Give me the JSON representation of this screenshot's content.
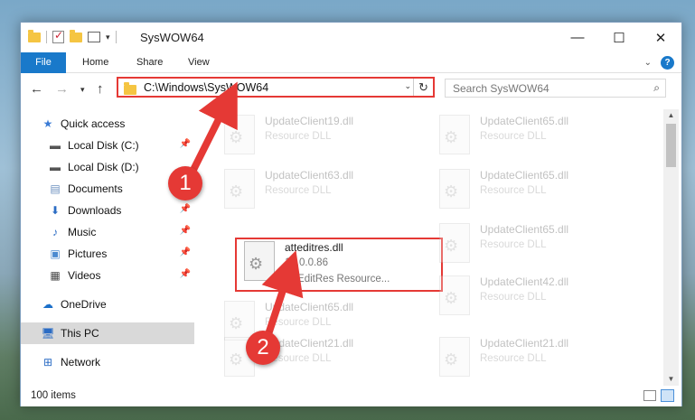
{
  "window": {
    "title": "SysWOW64",
    "controls": {
      "minimize": "—",
      "maximize": "☐",
      "close": "✕"
    }
  },
  "ribbon": {
    "tabs": [
      "File",
      "Home",
      "Share",
      "View"
    ],
    "help": "?",
    "collapse": "⌄"
  },
  "nav": {
    "back": "←",
    "forward": "→",
    "recent": "▾",
    "up": "↑",
    "address": "C:\\Windows\\SysWOW64",
    "address_dropdown": "⌄",
    "refresh": "↻",
    "search_placeholder": "Search SysWOW64",
    "search_icon": "⌕"
  },
  "sidebar": {
    "items": [
      {
        "label": "Quick access",
        "icon": "star-icon",
        "pinned": false
      },
      {
        "label": "Local Disk (C:)",
        "icon": "drive-icon",
        "pinned": true
      },
      {
        "label": "Local Disk (D:)",
        "icon": "drive-icon",
        "pinned": false
      },
      {
        "label": "Documents",
        "icon": "documents-icon",
        "pinned": true
      },
      {
        "label": "Downloads",
        "icon": "download-icon",
        "pinned": true
      },
      {
        "label": "Music",
        "icon": "music-icon",
        "pinned": true
      },
      {
        "label": "Pictures",
        "icon": "pictures-icon",
        "pinned": true
      },
      {
        "label": "Videos",
        "icon": "videos-icon",
        "pinned": true
      },
      {
        "label": "OneDrive",
        "icon": "cloud-icon",
        "pinned": false
      },
      {
        "label": "This PC",
        "icon": "pc-icon",
        "pinned": false,
        "selected": true
      },
      {
        "label": "Network",
        "icon": "network-icon",
        "pinned": false
      }
    ]
  },
  "files": {
    "faded": [
      {
        "name": "UpdateClient19.dll",
        "type": "Resource DLL"
      },
      {
        "name": "UpdateClient65.dll",
        "type": "Resource DLL"
      },
      {
        "name": "UpdateClient63.dll",
        "type": "Resource DLL"
      },
      {
        "name": "UpdateClient65.dll",
        "type": "Resource DLL"
      },
      {
        "name": "UpdateClient65.dll",
        "type": "Resource DLL"
      },
      {
        "name": "UpdateClient65.dll",
        "type": "Resource DLL"
      },
      {
        "name": "UpdateClient42.dll",
        "type": "Resource DLL"
      },
      {
        "name": "UpdateClient21.dll",
        "type": "Resource DLL"
      },
      {
        "name": "UpdateClient21.dll",
        "type": "Resource DLL"
      }
    ],
    "highlighted": {
      "name": "atteditres.dll",
      "version": "16.0.0.86",
      "description": "AttEditRes Resource..."
    }
  },
  "status": {
    "item_count": "100 items"
  },
  "annotations": {
    "step1": "1",
    "step2": "2",
    "color": "#e53935"
  }
}
